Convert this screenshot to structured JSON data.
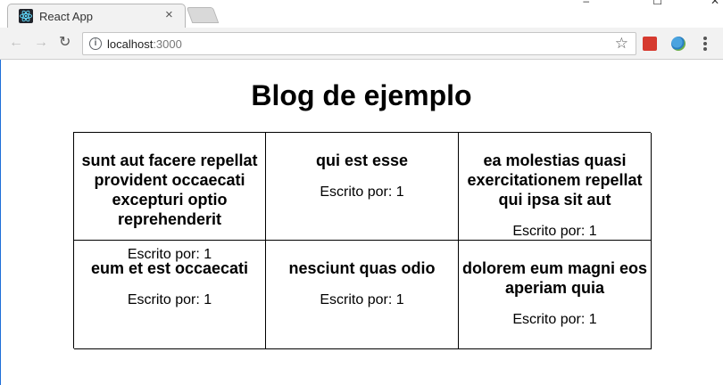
{
  "browser": {
    "tab_title": "React App",
    "tab_close": "×",
    "url_host": "localhost",
    "url_port": ":3000",
    "window_controls": {
      "minimize": "–",
      "maximize": "☐",
      "close": "✕"
    }
  },
  "page": {
    "title": "Blog de ejemplo",
    "posts": [
      {
        "title": "sunt aut facere repellat provident occaecati excepturi optio reprehenderit",
        "author": "Escrito por: 1"
      },
      {
        "title": "qui est esse",
        "author": "Escrito por: 1"
      },
      {
        "title": "ea molestias quasi exercitationem repellat qui ipsa sit aut",
        "author": "Escrito por: 1"
      },
      {
        "title": "eum et est occaecati",
        "author": "Escrito por: 1"
      },
      {
        "title": "nesciunt quas odio",
        "author": "Escrito por: 1"
      },
      {
        "title": "dolorem eum magni eos aperiam quia",
        "author": "Escrito por: 1"
      }
    ]
  },
  "colors": {
    "accent_scrollbar": "#1e6fd9",
    "extension_red": "#d63a2f"
  },
  "icons": [
    "react-favicon-icon",
    "close-icon",
    "back-icon",
    "forward-icon",
    "reload-icon",
    "info-icon",
    "star-icon",
    "extension-icon",
    "globe-extension-icon",
    "menu-icon"
  ]
}
